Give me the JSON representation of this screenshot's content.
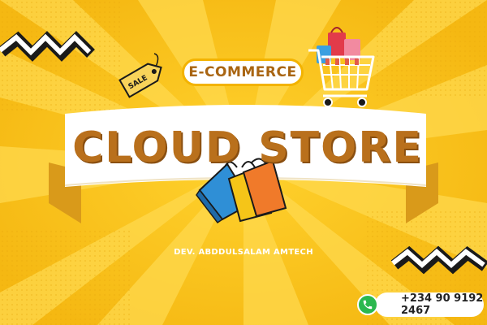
{
  "banner": {
    "badge_label": "E-COMMERCE",
    "title": "CLOUD STORE",
    "developer": "DEV. ABDDULSALAM AMTECH",
    "phone": "+234 90 9192 2467",
    "tag_label": "SALE"
  },
  "colors": {
    "background": "#f6c018",
    "ray_light": "#ffd84a",
    "ribbon_white": "#ffffff",
    "ribbon_fold": "#d99a1a",
    "title_brown": "#b9701c",
    "phone_green": "#2bb84f",
    "bag_blue": "#2f8fd6",
    "bag_yellow": "#f5c518",
    "bag_orange": "#f07a2a"
  },
  "icons": [
    "sale-tag-icon",
    "shopping-cart-icon",
    "shopping-bags-icon",
    "phone-icon",
    "zigzag-decoration"
  ]
}
